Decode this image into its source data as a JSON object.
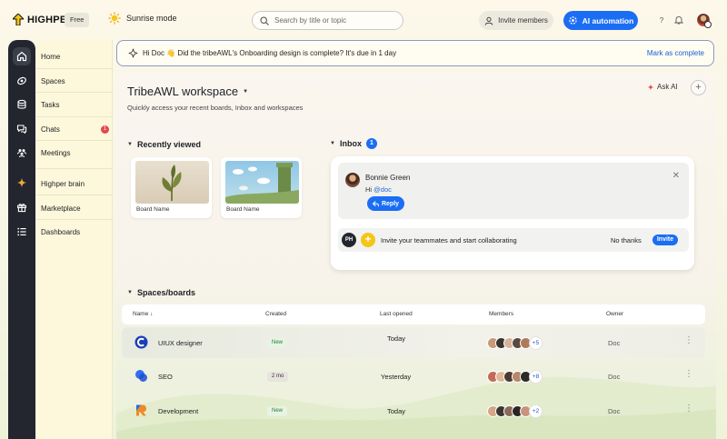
{
  "brand": {
    "name": "HIGHPER",
    "plan": "Free"
  },
  "topbar": {
    "mode_label": "Sunrise mode",
    "search_placeholder": "Search by title or topic",
    "invite_label": "Invite members",
    "ai_label": "AI automation",
    "help_label": "?"
  },
  "nav": {
    "items": [
      {
        "label": "Home",
        "icon": "home-icon"
      },
      {
        "label": "Spaces",
        "icon": "spaces-icon"
      },
      {
        "label": "Tasks",
        "icon": "tasks-icon"
      },
      {
        "label": "Chats",
        "icon": "chat-icon",
        "badge": "1"
      },
      {
        "label": "Meetings",
        "icon": "meetings-icon"
      },
      {
        "label": "Highper brain",
        "icon": "sparkle-icon"
      },
      {
        "label": "Marketplace",
        "icon": "gift-icon"
      },
      {
        "label": "Dashboards",
        "icon": "list-icon"
      }
    ]
  },
  "notice": {
    "text": "Hi Doc 👋 Did the tribeAWL's Onboarding design is complete? It's due in 1 day",
    "action": "Mark as complete"
  },
  "workspace": {
    "title": "TribeAWL workspace",
    "subtitle": "Quickly access your recent boards, Inbox and workspaces",
    "ask_ai": "Ask AI"
  },
  "recently_viewed": {
    "heading": "Recently viewed",
    "boards": [
      {
        "name": "Board Name"
      },
      {
        "name": "Board Name"
      }
    ]
  },
  "inbox": {
    "heading": "Inbox",
    "count": "1",
    "message": {
      "sender": "Bonnie Green",
      "greeting": "Hi ",
      "mention": "@doc",
      "reply": "Reply"
    },
    "invite": {
      "initials": "PH",
      "text": "Invite your teammates and start collaborating",
      "dismiss": "No thanks",
      "action": "Invite"
    }
  },
  "spaces": {
    "heading": "Spaces/boards",
    "columns": {
      "name": "Name",
      "created": "Created",
      "last_opened": "Last opened",
      "members": "Members",
      "owner": "Owner"
    },
    "rows": [
      {
        "name": "UIUX designer",
        "created": "New",
        "last_opened": "Today",
        "more": "+5",
        "owner": "Doc"
      },
      {
        "name": "SEO",
        "created": "2 mo",
        "last_opened": "Yesterday",
        "more": "+8",
        "owner": "Doc"
      },
      {
        "name": "Development",
        "created": "New",
        "last_opened": "Today",
        "more": "+2",
        "owner": "Doc"
      }
    ]
  },
  "colors": {
    "accent": "#1b6ef3",
    "rail": "#23262f",
    "badge": "#e5484d"
  }
}
